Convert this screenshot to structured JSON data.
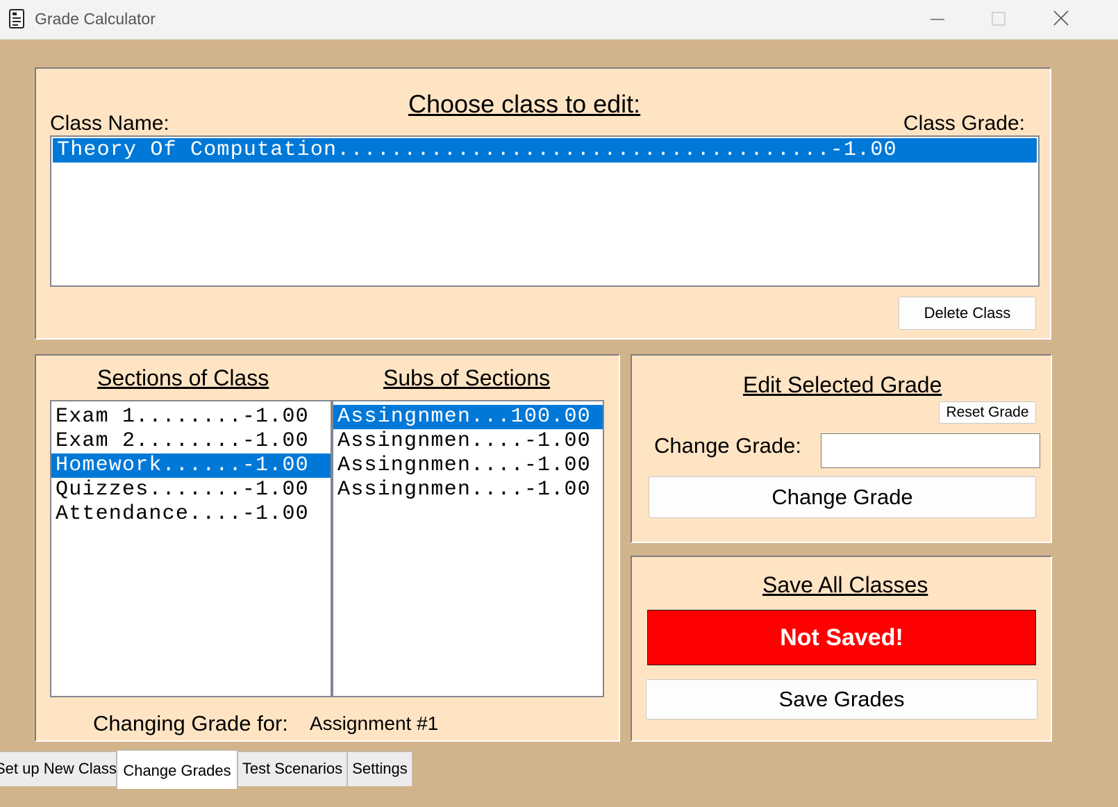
{
  "window": {
    "title": "Grade Calculator",
    "icon": "calculator-doc-icon",
    "controls": [
      "minimize-icon",
      "maximize-icon",
      "close-icon"
    ]
  },
  "classes_panel": {
    "heading": "Choose class to edit:",
    "class_name_label": "Class Name:",
    "class_grade_label": "Class Grade:",
    "classes": [
      {
        "text": "Theory Of Computation.....................................-1.00",
        "selected": true
      }
    ],
    "delete_button": "Delete Class"
  },
  "sections_panel": {
    "sections_heading": "Sections of Class",
    "subs_heading": "Subs of Sections",
    "sections": [
      {
        "text": "Exam 1........-1.00",
        "selected": false
      },
      {
        "text": "Exam 2........-1.00",
        "selected": false
      },
      {
        "text": "Homework......-1.00",
        "selected": true
      },
      {
        "text": "Quizzes.......-1.00",
        "selected": false
      },
      {
        "text": "Attendance....-1.00",
        "selected": false
      }
    ],
    "subs": [
      {
        "text": "Assingnmen...100.00",
        "selected": true
      },
      {
        "text": "Assingnmen....-1.00",
        "selected": false
      },
      {
        "text": "Assingnmen....-1.00",
        "selected": false
      },
      {
        "text": "Assingnmen....-1.00",
        "selected": false
      }
    ],
    "changing_label": "Changing Grade for:",
    "changing_value": "Assignment #1"
  },
  "edit_panel": {
    "heading": "Edit Selected Grade",
    "reset_button": "Reset Grade",
    "change_label": "Change Grade:",
    "change_input_value": "",
    "change_button": "Change Grade"
  },
  "save_panel": {
    "heading": "Save All Classes",
    "status": "Not Saved!",
    "status_color": "#ff0000",
    "save_button": "Save Grades"
  },
  "tabs": [
    {
      "label": "Set up New Class",
      "active": false
    },
    {
      "label": "Change Grades",
      "active": true
    },
    {
      "label": "Test Scenarios",
      "active": false
    },
    {
      "label": "Settings",
      "active": false
    }
  ],
  "colors": {
    "background": "#d2b48c",
    "panel": "#ffe4c4",
    "selection": "#0078d7"
  }
}
